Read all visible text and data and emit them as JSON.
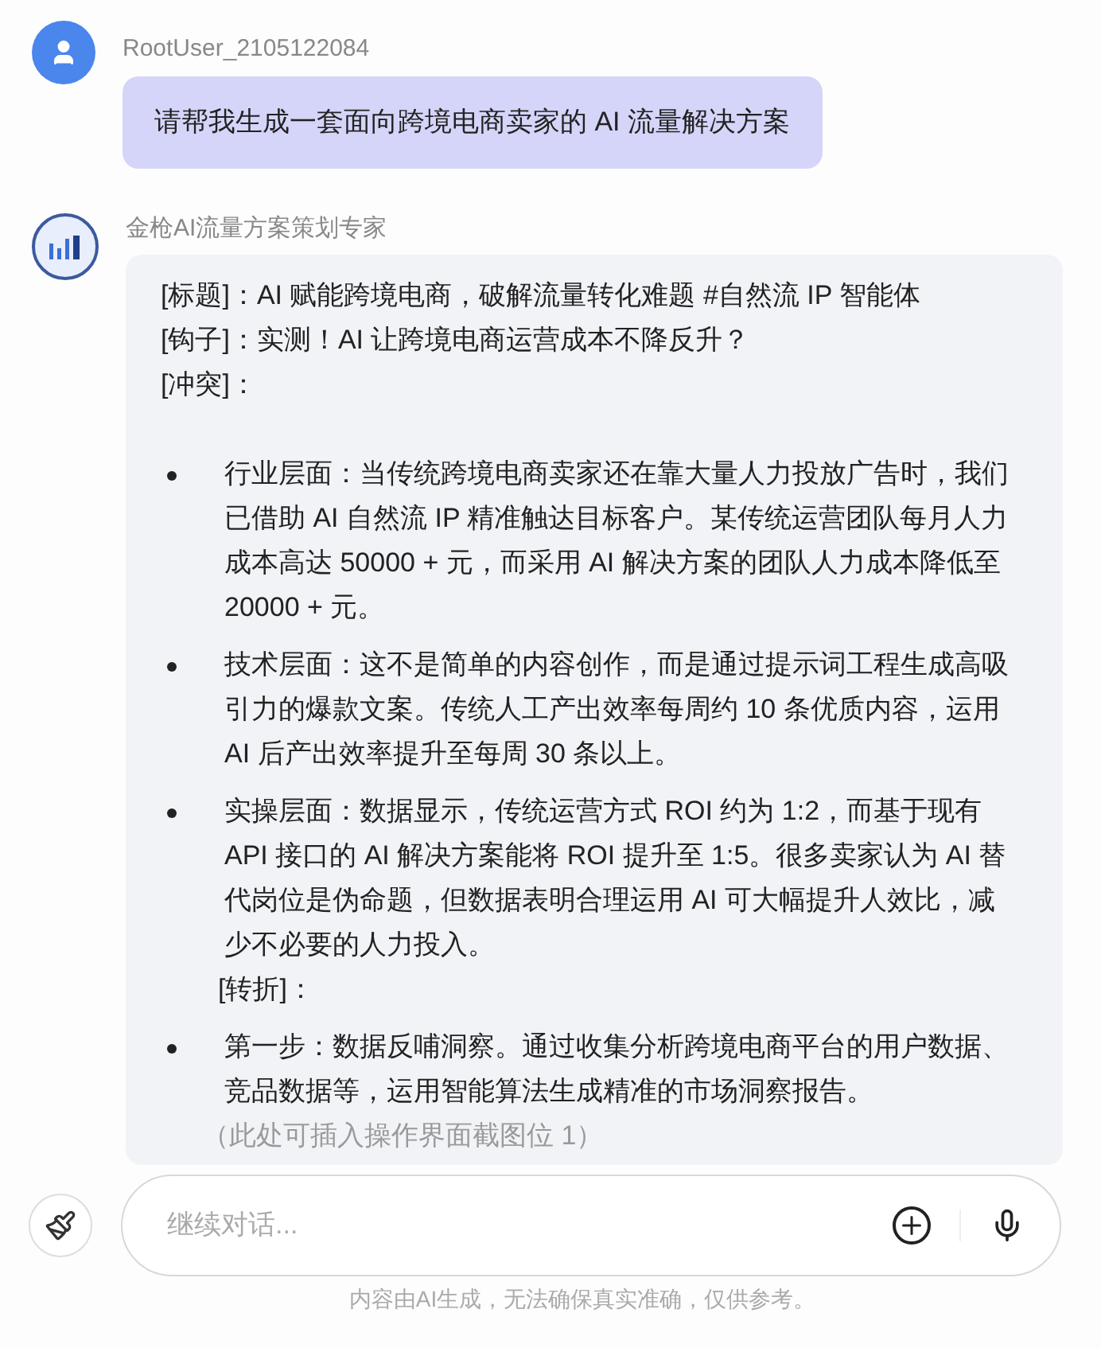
{
  "user_message": {
    "name": "RootUser_2105122084",
    "text": "请帮我生成一套面向跨境电商卖家的 AI 流量解决方案"
  },
  "bot_message": {
    "name": "金枪AI流量方案策划专家",
    "blocks": [
      {
        "kind": "line",
        "text": "[标题]：AI 赋能跨境电商，破解流量转化难题 #自然流 IP 智能体"
      },
      {
        "kind": "line",
        "text": "[钩子]：实测！AI 让跨境电商运营成本不降反升？"
      },
      {
        "kind": "line",
        "text": "[冲突]："
      },
      {
        "kind": "bullet",
        "text": "行业层面：当传统跨境电商卖家还在靠大量人力投放广告时，我们已借助 AI 自然流 IP 精准触达目标客户。某传统运营团队每月人力成本高达 50000 + 元，而采用 AI 解决方案的团队人力成本降低至 20000 + 元。"
      },
      {
        "kind": "bullet",
        "text": "技术层面：这不是简单的内容创作，而是通过提示词工程生成高吸引力的爆款文案。传统人工产出效率每周约 10 条优质内容，运用 AI 后产出效率提升至每周 30 条以上。"
      },
      {
        "kind": "bullet",
        "text": "实操层面：数据显示，传统运营方式 ROI 约为 1:2，而基于现有 API 接口的 AI 解决方案能将 ROI 提升至 1:5。很多卖家认为 AI 替代岗位是伪命题，但数据表明合理运用 AI 可大幅提升人效比，减少不必要的人力投入。"
      },
      {
        "kind": "subline",
        "text": "[转折]："
      },
      {
        "kind": "bullet",
        "text": "第一步：数据反哺洞察。通过收集分析跨境电商平台的用户数据、竞品数据等，运用智能算法生成精准的市场洞察报告。"
      },
      {
        "kind": "note",
        "text": "（此处可插入操作界面截图位 1）"
      }
    ]
  },
  "composer": {
    "placeholder": "继续对话..."
  },
  "disclaimer": "内容由AI生成，无法确保真实准确，仅供参考。"
}
